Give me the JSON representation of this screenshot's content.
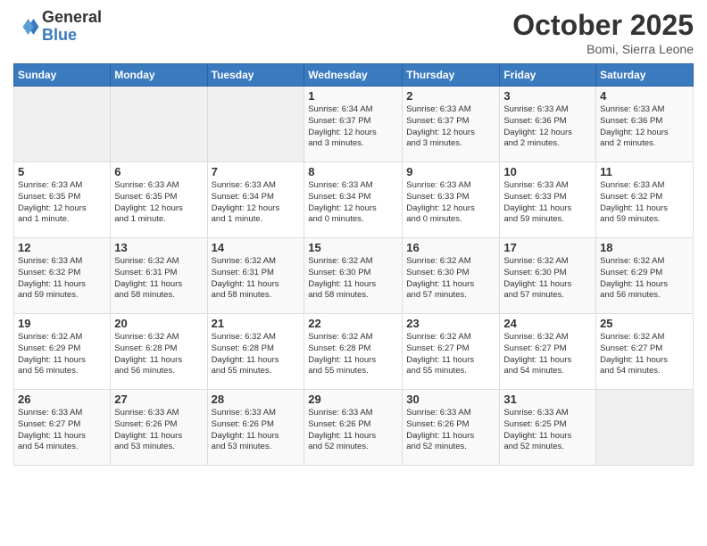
{
  "header": {
    "logo_general": "General",
    "logo_blue": "Blue",
    "month": "October 2025",
    "location": "Bomi, Sierra Leone"
  },
  "days_of_week": [
    "Sunday",
    "Monday",
    "Tuesday",
    "Wednesday",
    "Thursday",
    "Friday",
    "Saturday"
  ],
  "weeks": [
    [
      {
        "day": "",
        "info": ""
      },
      {
        "day": "",
        "info": ""
      },
      {
        "day": "",
        "info": ""
      },
      {
        "day": "1",
        "info": "Sunrise: 6:34 AM\nSunset: 6:37 PM\nDaylight: 12 hours\nand 3 minutes."
      },
      {
        "day": "2",
        "info": "Sunrise: 6:33 AM\nSunset: 6:37 PM\nDaylight: 12 hours\nand 3 minutes."
      },
      {
        "day": "3",
        "info": "Sunrise: 6:33 AM\nSunset: 6:36 PM\nDaylight: 12 hours\nand 2 minutes."
      },
      {
        "day": "4",
        "info": "Sunrise: 6:33 AM\nSunset: 6:36 PM\nDaylight: 12 hours\nand 2 minutes."
      }
    ],
    [
      {
        "day": "5",
        "info": "Sunrise: 6:33 AM\nSunset: 6:35 PM\nDaylight: 12 hours\nand 1 minute."
      },
      {
        "day": "6",
        "info": "Sunrise: 6:33 AM\nSunset: 6:35 PM\nDaylight: 12 hours\nand 1 minute."
      },
      {
        "day": "7",
        "info": "Sunrise: 6:33 AM\nSunset: 6:34 PM\nDaylight: 12 hours\nand 1 minute."
      },
      {
        "day": "8",
        "info": "Sunrise: 6:33 AM\nSunset: 6:34 PM\nDaylight: 12 hours\nand 0 minutes."
      },
      {
        "day": "9",
        "info": "Sunrise: 6:33 AM\nSunset: 6:33 PM\nDaylight: 12 hours\nand 0 minutes."
      },
      {
        "day": "10",
        "info": "Sunrise: 6:33 AM\nSunset: 6:33 PM\nDaylight: 11 hours\nand 59 minutes."
      },
      {
        "day": "11",
        "info": "Sunrise: 6:33 AM\nSunset: 6:32 PM\nDaylight: 11 hours\nand 59 minutes."
      }
    ],
    [
      {
        "day": "12",
        "info": "Sunrise: 6:33 AM\nSunset: 6:32 PM\nDaylight: 11 hours\nand 59 minutes."
      },
      {
        "day": "13",
        "info": "Sunrise: 6:32 AM\nSunset: 6:31 PM\nDaylight: 11 hours\nand 58 minutes."
      },
      {
        "day": "14",
        "info": "Sunrise: 6:32 AM\nSunset: 6:31 PM\nDaylight: 11 hours\nand 58 minutes."
      },
      {
        "day": "15",
        "info": "Sunrise: 6:32 AM\nSunset: 6:30 PM\nDaylight: 11 hours\nand 58 minutes."
      },
      {
        "day": "16",
        "info": "Sunrise: 6:32 AM\nSunset: 6:30 PM\nDaylight: 11 hours\nand 57 minutes."
      },
      {
        "day": "17",
        "info": "Sunrise: 6:32 AM\nSunset: 6:30 PM\nDaylight: 11 hours\nand 57 minutes."
      },
      {
        "day": "18",
        "info": "Sunrise: 6:32 AM\nSunset: 6:29 PM\nDaylight: 11 hours\nand 56 minutes."
      }
    ],
    [
      {
        "day": "19",
        "info": "Sunrise: 6:32 AM\nSunset: 6:29 PM\nDaylight: 11 hours\nand 56 minutes."
      },
      {
        "day": "20",
        "info": "Sunrise: 6:32 AM\nSunset: 6:28 PM\nDaylight: 11 hours\nand 56 minutes."
      },
      {
        "day": "21",
        "info": "Sunrise: 6:32 AM\nSunset: 6:28 PM\nDaylight: 11 hours\nand 55 minutes."
      },
      {
        "day": "22",
        "info": "Sunrise: 6:32 AM\nSunset: 6:28 PM\nDaylight: 11 hours\nand 55 minutes."
      },
      {
        "day": "23",
        "info": "Sunrise: 6:32 AM\nSunset: 6:27 PM\nDaylight: 11 hours\nand 55 minutes."
      },
      {
        "day": "24",
        "info": "Sunrise: 6:32 AM\nSunset: 6:27 PM\nDaylight: 11 hours\nand 54 minutes."
      },
      {
        "day": "25",
        "info": "Sunrise: 6:32 AM\nSunset: 6:27 PM\nDaylight: 11 hours\nand 54 minutes."
      }
    ],
    [
      {
        "day": "26",
        "info": "Sunrise: 6:33 AM\nSunset: 6:27 PM\nDaylight: 11 hours\nand 54 minutes."
      },
      {
        "day": "27",
        "info": "Sunrise: 6:33 AM\nSunset: 6:26 PM\nDaylight: 11 hours\nand 53 minutes."
      },
      {
        "day": "28",
        "info": "Sunrise: 6:33 AM\nSunset: 6:26 PM\nDaylight: 11 hours\nand 53 minutes."
      },
      {
        "day": "29",
        "info": "Sunrise: 6:33 AM\nSunset: 6:26 PM\nDaylight: 11 hours\nand 52 minutes."
      },
      {
        "day": "30",
        "info": "Sunrise: 6:33 AM\nSunset: 6:26 PM\nDaylight: 11 hours\nand 52 minutes."
      },
      {
        "day": "31",
        "info": "Sunrise: 6:33 AM\nSunset: 6:25 PM\nDaylight: 11 hours\nand 52 minutes."
      },
      {
        "day": "",
        "info": ""
      }
    ]
  ]
}
